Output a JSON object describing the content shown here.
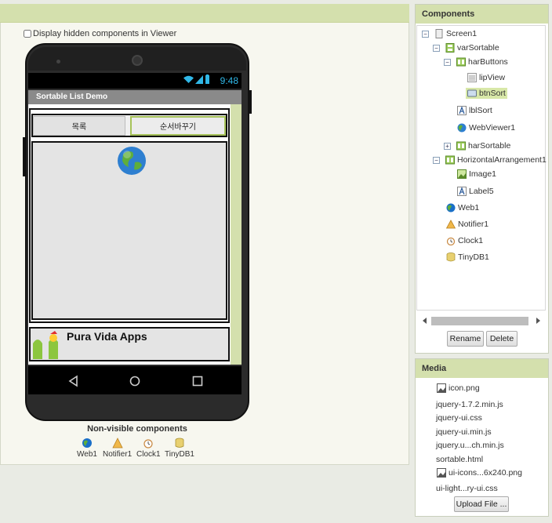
{
  "viewer": {
    "hidden_checkbox_label": "Display hidden components in Viewer",
    "status_time": "9:48",
    "app_title": "Sortable List Demo",
    "btn_list_label": "목록",
    "btn_sort_label": "순서바꾸기",
    "label5_text": "Pura Vida Apps",
    "nonvisible_title": "Non-visible components",
    "nonvisible": [
      "Web1",
      "Notifier1",
      "Clock1",
      "TinyDB1"
    ]
  },
  "components": {
    "title": "Components",
    "tree": [
      "Screen1",
      "varSortable",
      "harButtons",
      "lipView",
      "btnSort",
      "lblSort",
      "WebViewer1",
      "harSortable",
      "HorizontalArrangement1",
      "Image1",
      "Label5",
      "Web1",
      "Notifier1",
      "Clock1",
      "TinyDB1"
    ],
    "selected": "btnSort",
    "rename_label": "Rename",
    "delete_label": "Delete"
  },
  "media": {
    "title": "Media",
    "files": [
      "icon.png",
      "jquery-1.7.2.min.js",
      "jquery-ui.css",
      "jquery-ui.min.js",
      "jquery.u...ch.min.js",
      "sortable.html",
      "ui-icons...6x240.png",
      "ui-light...ry-ui.css"
    ],
    "upload_label": "Upload File ..."
  },
  "colors": {
    "accent": "#d4e0ad",
    "selected": "#d8e8a8",
    "status_blue": "#30b8e8"
  }
}
